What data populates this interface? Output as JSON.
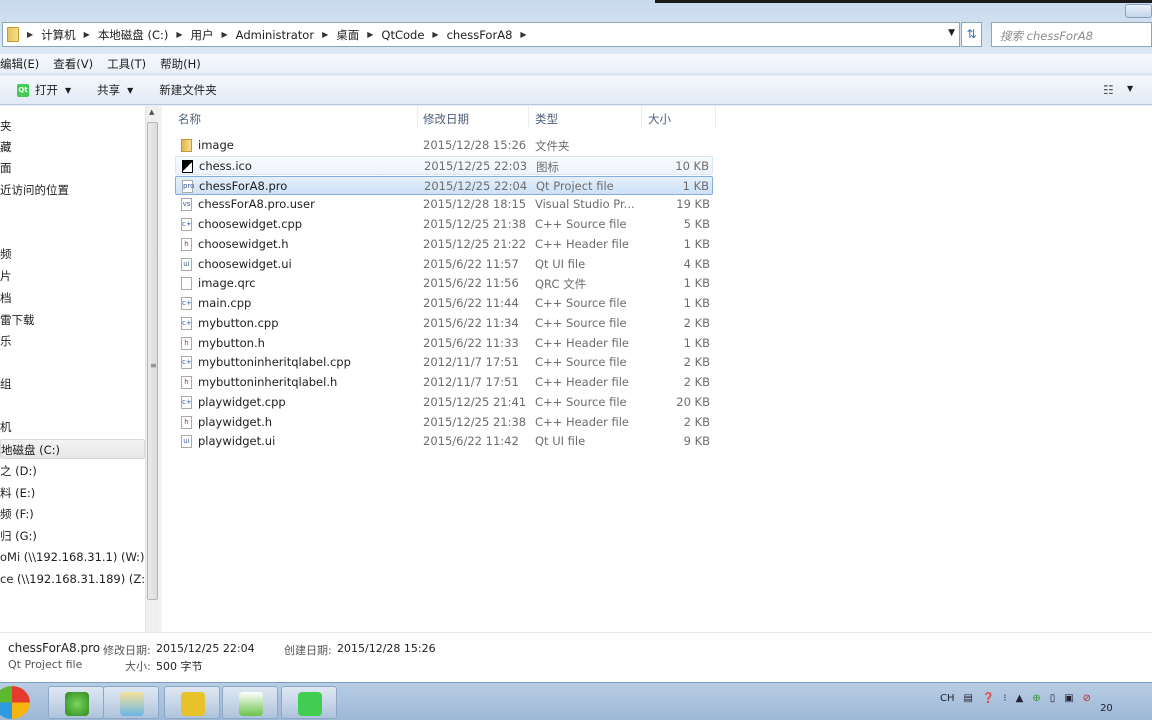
{
  "address": {
    "crumbs": [
      "计算机",
      "本地磁盘 (C:)",
      "用户",
      "Administrator",
      "桌面",
      "QtCode",
      "chessForA8"
    ],
    "search_placeholder": "搜索 chessForA8"
  },
  "menu": [
    "编辑(E)",
    "查看(V)",
    "工具(T)",
    "帮助(H)"
  ],
  "toolbar": {
    "open": "打开",
    "share": "共享",
    "new_folder": "新建文件夹"
  },
  "nav": [
    {
      "label": "夹"
    },
    {
      "label": "藏"
    },
    {
      "label": "面"
    },
    {
      "label": "近访问的位置"
    },
    {
      "label": "频"
    },
    {
      "label": "片"
    },
    {
      "label": "档"
    },
    {
      "label": "雷下载"
    },
    {
      "label": "乐"
    },
    {
      "label": "组"
    },
    {
      "label": "机"
    },
    {
      "label": "地磁盘 (C:)",
      "selected": true
    },
    {
      "label": "之 (D:)"
    },
    {
      "label": "料 (E:)"
    },
    {
      "label": "频 (F:)"
    },
    {
      "label": "归 (G:)"
    },
    {
      "label": "oMi (\\\\192.168.31.1) (W:)"
    },
    {
      "label": "ce (\\\\192.168.31.189) (Z:)"
    }
  ],
  "columns": {
    "name": "名称",
    "date": "修改日期",
    "type": "类型",
    "size": "大小"
  },
  "files": [
    {
      "icon": "folder",
      "name": "image",
      "date": "2015/12/28 15:26",
      "type": "文件夹",
      "size": ""
    },
    {
      "icon": "chess",
      "name": "chess.ico",
      "date": "2015/12/25 22:03",
      "type": "图标",
      "size": "10 KB",
      "state": "hover"
    },
    {
      "icon": "pro",
      "name": "chessForA8.pro",
      "date": "2015/12/25 22:04",
      "type": "Qt Project file",
      "size": "1 KB",
      "state": "selected"
    },
    {
      "icon": "vs",
      "name": "chessForA8.pro.user",
      "date": "2015/12/28 18:15",
      "type": "Visual Studio Pr...",
      "size": "19 KB"
    },
    {
      "icon": "cpp",
      "name": "choosewidget.cpp",
      "date": "2015/12/25 21:38",
      "type": "C++ Source file",
      "size": "5 KB"
    },
    {
      "icon": "h",
      "name": "choosewidget.h",
      "date": "2015/12/25 21:22",
      "type": "C++ Header file",
      "size": "1 KB"
    },
    {
      "icon": "ui",
      "name": "choosewidget.ui",
      "date": "2015/6/22 11:57",
      "type": "Qt UI file",
      "size": "4 KB"
    },
    {
      "icon": "file",
      "name": "image.qrc",
      "date": "2015/6/22 11:56",
      "type": "QRC 文件",
      "size": "1 KB"
    },
    {
      "icon": "cpp",
      "name": "main.cpp",
      "date": "2015/6/22 11:44",
      "type": "C++ Source file",
      "size": "1 KB"
    },
    {
      "icon": "cpp",
      "name": "mybutton.cpp",
      "date": "2015/6/22 11:34",
      "type": "C++ Source file",
      "size": "2 KB"
    },
    {
      "icon": "h",
      "name": "mybutton.h",
      "date": "2015/6/22 11:33",
      "type": "C++ Header file",
      "size": "1 KB"
    },
    {
      "icon": "cpp",
      "name": "mybuttoninheritqlabel.cpp",
      "date": "2012/11/7 17:51",
      "type": "C++ Source file",
      "size": "2 KB"
    },
    {
      "icon": "h",
      "name": "mybuttoninheritqlabel.h",
      "date": "2012/11/7 17:51",
      "type": "C++ Header file",
      "size": "2 KB"
    },
    {
      "icon": "cpp",
      "name": "playwidget.cpp",
      "date": "2015/12/25 21:41",
      "type": "C++ Source file",
      "size": "20 KB"
    },
    {
      "icon": "h",
      "name": "playwidget.h",
      "date": "2015/12/25 21:38",
      "type": "C++ Header file",
      "size": "2 KB"
    },
    {
      "icon": "ui",
      "name": "playwidget.ui",
      "date": "2015/6/22 11:42",
      "type": "Qt UI file",
      "size": "9 KB"
    }
  ],
  "status": {
    "name": "chessForA8.pro",
    "modified_label": "修改日期:",
    "modified": "2015/12/25 22:04",
    "created_label": "创建日期:",
    "created": "2015/12/28 15:26",
    "type": "Qt Project file",
    "size_label": "大小:",
    "size": "500 字节"
  },
  "tray": {
    "ime": "CH",
    "clock_partial": "20"
  }
}
